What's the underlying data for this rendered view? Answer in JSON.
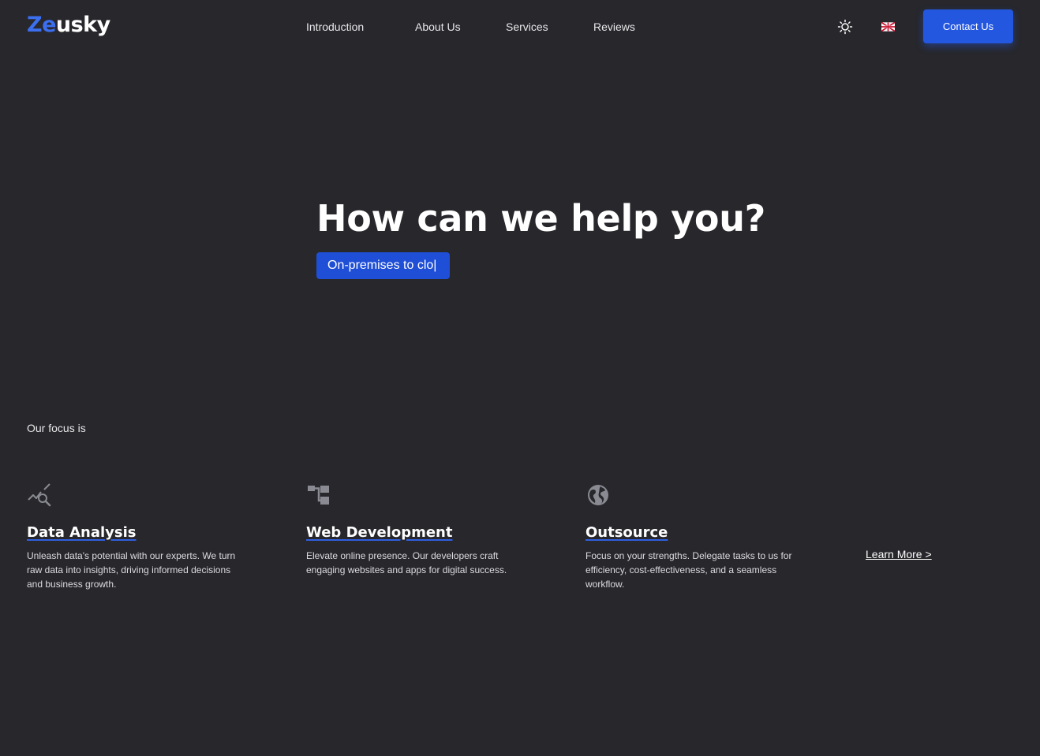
{
  "brand": {
    "logo_accent": "Ze",
    "logo_rest": "usky",
    "accent_color": "#3b6ff0"
  },
  "nav": {
    "items": [
      {
        "label": "Introduction"
      },
      {
        "label": "About Us"
      },
      {
        "label": "Services"
      },
      {
        "label": "Reviews"
      }
    ],
    "theme_icon": "sun-icon",
    "language_icon": "uk-flag-icon",
    "contact_label": "Contact Us",
    "contact_color": "#2457e0"
  },
  "hero": {
    "title": "How can we help you?",
    "chip_text": "On-premises to clo|"
  },
  "focus": {
    "label": "Our focus is",
    "cards": [
      {
        "icon": "analytics-icon",
        "title": "Data Analysis",
        "text": "Unleash data's potential with our experts. We turn raw data into insights, driving informed decisions and business growth."
      },
      {
        "icon": "hierarchy-icon",
        "title": "Web Development",
        "text": "Elevate online presence. Our developers craft engaging websites and apps for digital success."
      },
      {
        "icon": "globe-icon",
        "title": "Outsource",
        "text": "Focus on your strengths. Delegate tasks to us for efficiency, cost-effectiveness, and a seamless workflow."
      }
    ],
    "learn_more": "Learn More >"
  },
  "colors": {
    "background": "#27272c",
    "text": "#ffffff",
    "icon_gray": "#8a8a93"
  }
}
